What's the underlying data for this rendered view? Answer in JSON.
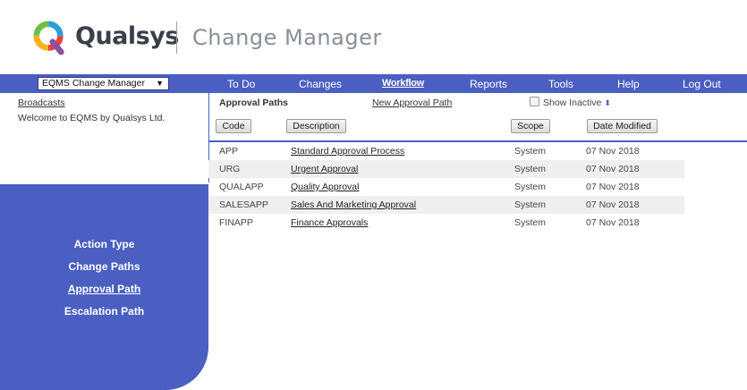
{
  "header": {
    "brand": "Qualsys",
    "product": "Change Manager"
  },
  "navbar": {
    "module_select": "EQMS Change Manager",
    "items": [
      "To Do",
      "Changes",
      "Workflow",
      "Reports",
      "Tools",
      "Help",
      "Log Out"
    ],
    "active": "Workflow"
  },
  "left_panel": {
    "broadcasts": "Broadcasts",
    "welcome": "Welcome to EQMS by Qualsys Ltd.",
    "links": [
      "Action Type",
      "Change Paths",
      "Approval Path",
      "Escalation Path"
    ],
    "current_link": "Approval Path"
  },
  "main": {
    "title": "Approval Paths",
    "new_link": "New Approval Path",
    "show_inactive_label": "Show Inactive",
    "show_inactive_checked": false,
    "columns": [
      "Code",
      "Description",
      "Scope",
      "Date Modified"
    ],
    "rows": [
      {
        "code": "APP",
        "description": "Standard Approval Process",
        "scope": "System",
        "date": "07 Nov 2018"
      },
      {
        "code": "URG",
        "description": "Urgent Approval",
        "scope": "System",
        "date": "07 Nov 2018"
      },
      {
        "code": "QUALAPP",
        "description": "Quality Approval",
        "scope": "System",
        "date": "07 Nov 2018"
      },
      {
        "code": "SALESAPP",
        "description": "Sales And Marketing Approval",
        "scope": "System",
        "date": "07 Nov 2018"
      },
      {
        "code": "FINAPP",
        "description": "Finance Approvals",
        "scope": "System",
        "date": "07 Nov 2018"
      }
    ]
  },
  "colors": {
    "accent": "#4a5fc1",
    "row_alt": "#efefef",
    "logo_colors": [
      "#e8433a",
      "#f7b31b",
      "#6cbf4a",
      "#2a9fd8",
      "#8d4fa0"
    ]
  }
}
